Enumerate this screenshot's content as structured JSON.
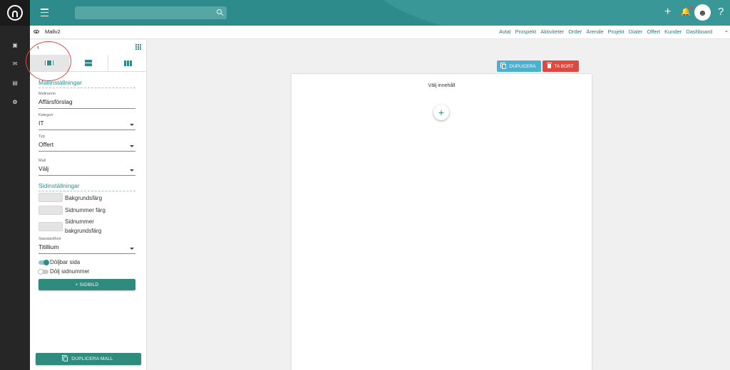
{
  "colors": {
    "accent": "#2e8b8b",
    "danger": "#e0483f",
    "info": "#4ab0cf"
  },
  "rail": {
    "items": [
      "calendar-icon",
      "mail-icon",
      "document-icon",
      "gear-icon"
    ]
  },
  "topbar": {
    "search": {
      "placeholder": ""
    },
    "add": "+",
    "bell": "🔔",
    "avatar": "☻",
    "help": "?"
  },
  "breadcrumb": "Mallv2",
  "nav": {
    "links": [
      "Avtal",
      "Prospekt",
      "Aktiviteter",
      "Order",
      "Ärende",
      "Projekt",
      "Dialer",
      "Offert",
      "Kunder",
      "Dashboard"
    ],
    "chevron": "⌄"
  },
  "panel": {
    "back": "‹",
    "tabs": [
      "single-column-icon",
      "rows-icon",
      "three-columns-icon"
    ],
    "template_section": "Mallinställningar",
    "fields": [
      {
        "label": "Mallnamn",
        "value": "Affärsförslag",
        "dropdown": false
      },
      {
        "label": "Kategori",
        "value": "IT",
        "dropdown": true
      },
      {
        "label": "Typ",
        "value": "Offert",
        "dropdown": true
      },
      {
        "label": "Mall",
        "value": "Välj",
        "dropdown": true
      }
    ],
    "page_section": "Sidinställningar",
    "swatches": [
      "Bakgrundsfärg",
      "Sidnummer färg",
      "Sidnummer",
      "bakgrundsfärg"
    ],
    "font": {
      "label": "Standardfont",
      "value": "Titillium"
    },
    "toggles": [
      {
        "label": "Döljbar sida",
        "on": true
      },
      {
        "label": "Dölj sidnummer",
        "on": false
      }
    ],
    "page_image_button": "+ SIDBILD",
    "duplicate_template_button": "DUPLICERA MALL"
  },
  "canvas": {
    "duplicate_button": "DUPLICERA",
    "delete_button": "TA BORT",
    "choose_content": "Välj innehåll",
    "add": "+"
  }
}
